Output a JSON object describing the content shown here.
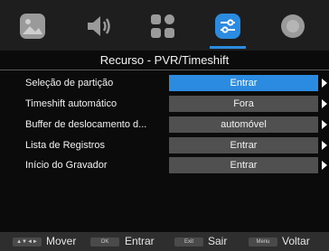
{
  "tabs": [
    {
      "icon": "picture-icon",
      "active": false
    },
    {
      "icon": "speaker-icon",
      "active": false
    },
    {
      "icon": "apps-grid-icon",
      "active": false
    },
    {
      "icon": "settings-sliders-icon",
      "active": true
    },
    {
      "icon": "circle-icon",
      "active": false
    }
  ],
  "panel": {
    "title": "Recurso - PVR/Timeshift",
    "items": [
      {
        "label": "Seleção de partição",
        "value": "Entrar",
        "selected": true
      },
      {
        "label": "Timeshift automático",
        "value": "Fora",
        "selected": false
      },
      {
        "label": "Buffer de deslocamento d...",
        "value": "automóvel",
        "selected": false
      },
      {
        "label": "Lista de Registros",
        "value": "Entrar",
        "selected": false
      },
      {
        "label": "Início do Gravador",
        "value": "Entrar",
        "selected": false
      }
    ]
  },
  "hints": {
    "move_key": "▲▼◄►",
    "move_label": "Mover",
    "ok_key": "OK",
    "ok_label": "Entrar",
    "exit_key": "Exit",
    "exit_label": "Sair",
    "menu_key": "Menu",
    "menu_label": "Voltar"
  },
  "colors": {
    "accent": "#2a8be0",
    "value_bg": "#505050",
    "panel_bg": "#0b0b0b",
    "tabbar_bg": "#1e1e1e"
  }
}
